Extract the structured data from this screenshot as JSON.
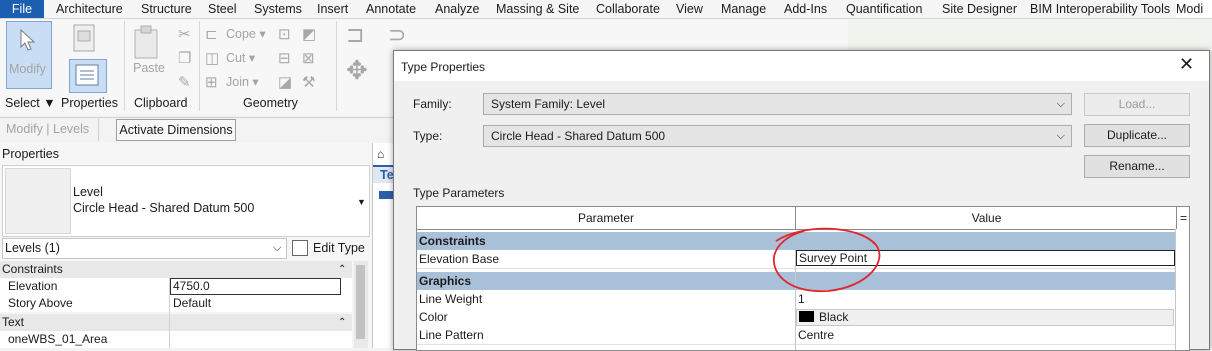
{
  "ribbon": {
    "tabs": [
      "File",
      "Architecture",
      "Structure",
      "Steel",
      "Systems",
      "Insert",
      "Annotate",
      "Analyze",
      "Massing & Site",
      "Collaborate",
      "View",
      "Manage",
      "Add-Ins",
      "Quantification",
      "Site Designer",
      "BIM Interoperability Tools",
      "Modi"
    ],
    "modify_label": "Modify",
    "select_label": "Select ▼",
    "properties_label": "Properties",
    "paste_label": "Paste",
    "clipboard_label": "Clipboard",
    "cope_label": "Cope ▾",
    "cut_label": "Cut ▾",
    "join_label": "Join ▾",
    "geometry_label": "Geometry"
  },
  "options_bar": {
    "context": "Modify | Levels",
    "activate_dimensions": "Activate Dimensions"
  },
  "properties": {
    "title": "Properties",
    "type_family": "Level",
    "type_name": "Circle Head - Shared Datum 500",
    "instance_filter": "Levels (1)",
    "edit_type": "Edit Type",
    "rows": [
      {
        "label": "Constraints",
        "value": "",
        "group": true
      },
      {
        "label": "Elevation",
        "value": "4750.0",
        "group": false
      },
      {
        "label": "Story Above",
        "value": "Default",
        "group": false
      },
      {
        "label": "Text",
        "value": "",
        "group": true
      },
      {
        "label": "oneWBS_01_Area",
        "value": "",
        "group": false
      }
    ]
  },
  "view_tab_fragment": "Te",
  "dialog": {
    "title": "Type Properties",
    "family_label": "Family:",
    "family_value": "System Family: Level",
    "type_label": "Type:",
    "type_value": "Circle Head - Shared Datum 500",
    "load_button": "Load...",
    "duplicate_button": "Duplicate...",
    "rename_button": "Rename...",
    "section_label": "Type Parameters",
    "col_parameter": "Parameter",
    "col_value": "Value",
    "col_extra": "=",
    "rows": [
      {
        "label": "Constraints",
        "value": "",
        "group": true
      },
      {
        "label": "Elevation Base",
        "value": "Survey Point",
        "group": false
      },
      {
        "label": "Graphics",
        "value": "",
        "group": true
      },
      {
        "label": "Line Weight",
        "value": "1",
        "group": false
      },
      {
        "label": "Color",
        "value": "Black",
        "group": false
      },
      {
        "label": "Line Pattern",
        "value": "Centre",
        "group": false
      }
    ]
  },
  "colors": {
    "file_tab": "#1c5eb0",
    "group_header": "#a9c0d9",
    "highlight_circle": "#e0252b"
  }
}
